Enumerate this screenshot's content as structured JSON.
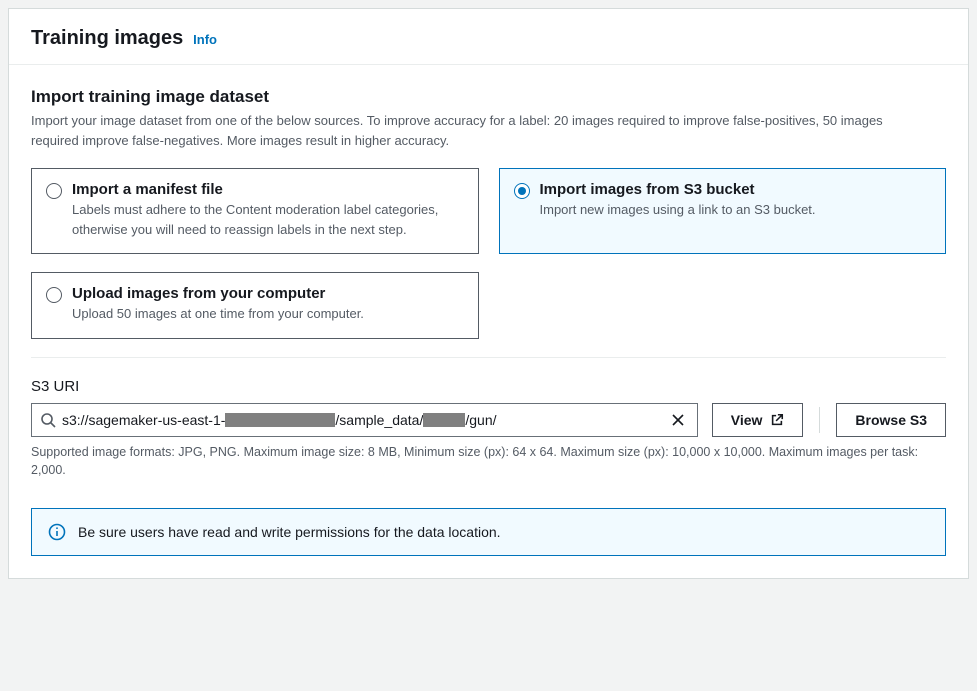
{
  "panel": {
    "title": "Training images",
    "info_label": "Info"
  },
  "section": {
    "title": "Import training image dataset",
    "description": "Import your image dataset from one of the below sources. To improve accuracy for a label: 20 images required to improve false-positives, 50 images required improve false-negatives. More images result in higher accuracy."
  },
  "options": {
    "manifest": {
      "title": "Import a manifest file",
      "description": "Labels must adhere to the Content moderation label categories, otherwise you will need to reassign labels in the next step."
    },
    "s3": {
      "title": "Import images from S3 bucket",
      "description": "Import new images using a link to an S3 bucket."
    },
    "upload": {
      "title": "Upload images from your computer",
      "description": "Upload 50 images at one time from your computer."
    },
    "selected": "s3"
  },
  "s3uri": {
    "label": "S3 URI",
    "value_prefix": "s3://sagemaker-us-east-1-",
    "value_mid1": "/sample_data/",
    "value_suffix": "/gun/",
    "helper": "Supported image formats: JPG, PNG. Maximum image size: 8 MB, Minimum size (px): 64 x 64. Maximum size (px): 10,000 x 10,000. Maximum images per task: 2,000."
  },
  "buttons": {
    "view": "View",
    "browse": "Browse S3"
  },
  "infobox": {
    "message": "Be sure users have read and write permissions for the data location."
  }
}
